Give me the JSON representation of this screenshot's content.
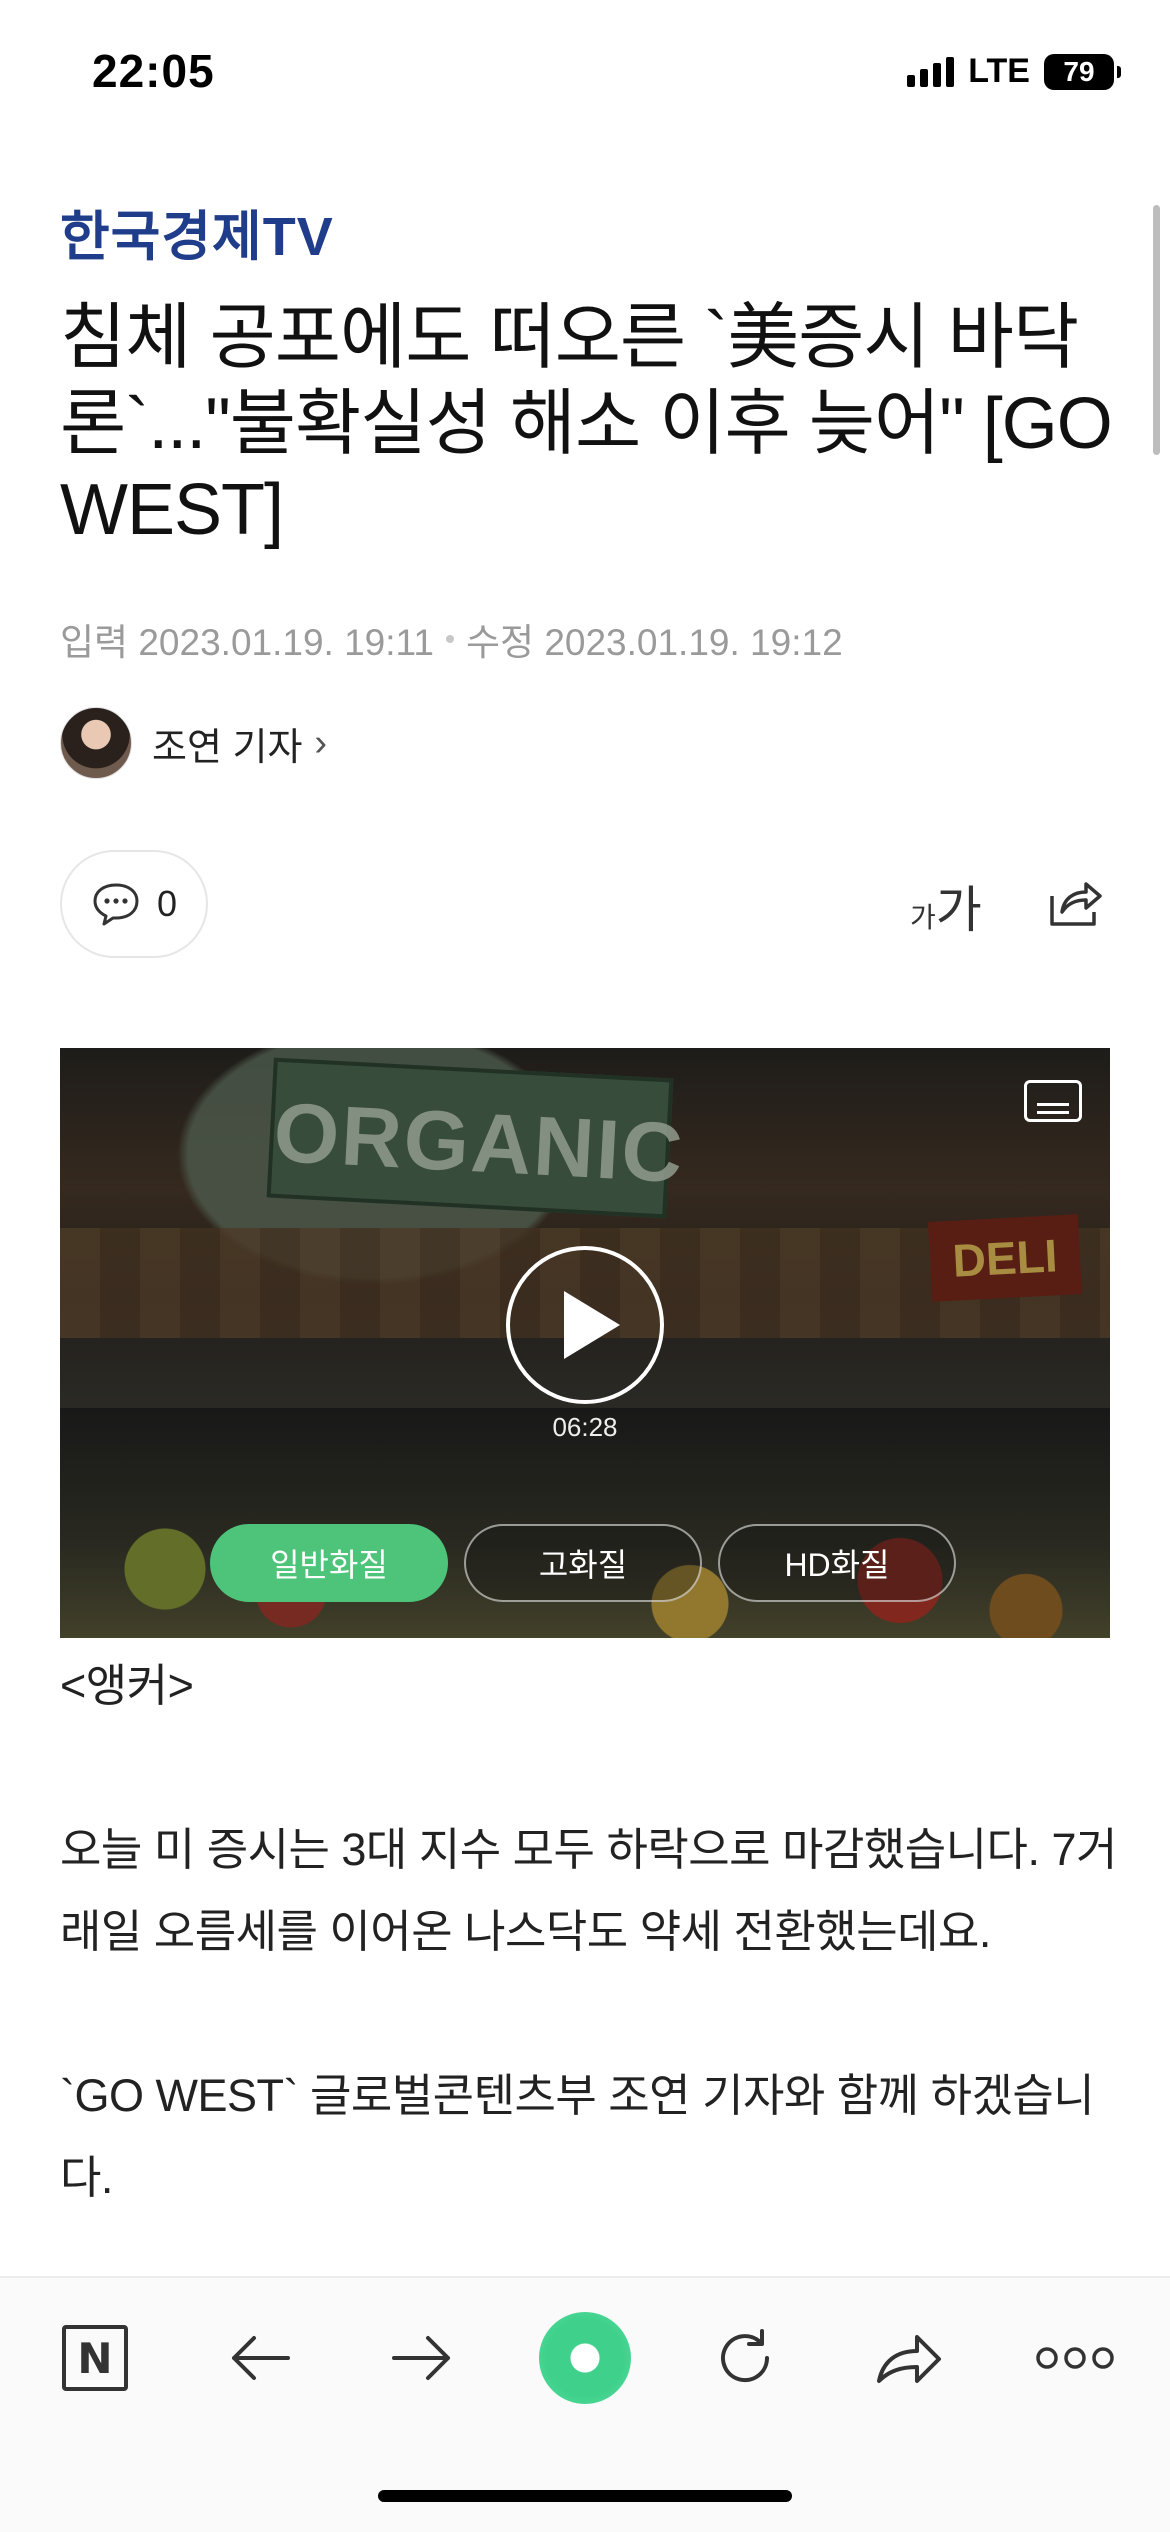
{
  "status_bar": {
    "time": "22:05",
    "network": "LTE",
    "battery": "79"
  },
  "article": {
    "press": "한국경제TV",
    "title": "침체 공포에도 떠오른 `美증시 바닥론`...\"불확실성 해소 이후 늦어\" [GO WEST]",
    "published": "입력 2023.01.19. 19:11",
    "modified": "수정 2023.01.19. 19:12",
    "reporter": "조연 기자",
    "comment_count": "0",
    "font_small": "가",
    "font_big": "가",
    "body": [
      "<앵커>",
      "오늘 미 증시는 3대 지수 모두 하락으로 마감했습니다. 7거래일 오름세를 이어온 나스닥도 약세 전환했는데요.",
      "`GO WEST` 글로벌콘텐츠부 조연 기자와 함께 하겠습니다."
    ]
  },
  "video": {
    "duration": "06:28",
    "scene_text": "ORGANIC",
    "scene_sign": "DELI",
    "quality_options": [
      "일반화질",
      "고화질",
      "HD화질"
    ],
    "selected_quality": "일반화질"
  },
  "toolbar": {
    "icons": [
      "naver-n-icon",
      "back-arrow-icon",
      "forward-arrow-icon",
      "green-dot-icon",
      "refresh-icon",
      "share-arrow-icon",
      "more-icon"
    ],
    "n_label": "N"
  },
  "colors": {
    "press_blue": "#1f3d8a",
    "accent_green": "#4dc47a",
    "meta_gray": "#9a9a9a"
  }
}
